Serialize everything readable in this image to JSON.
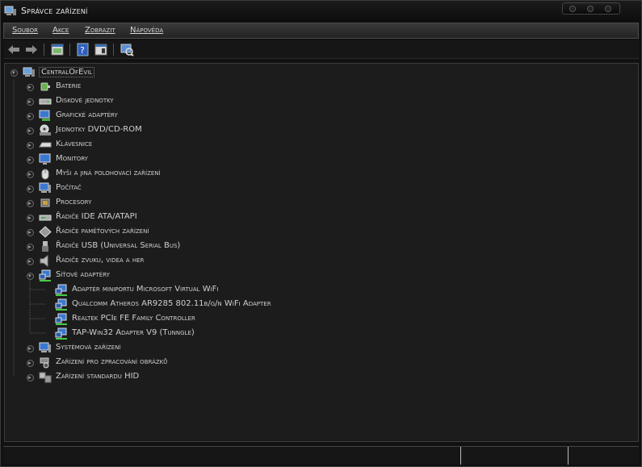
{
  "window": {
    "title": "Správce zařízení"
  },
  "menu": [
    "Soubor",
    "Akce",
    "Zobrazit",
    "Nápověda"
  ],
  "toolbar": {
    "buttons": [
      "back-arrow-icon",
      "forward-arrow-icon",
      "properties-icon",
      "help-icon",
      "view-icon",
      "scan-hardware-icon"
    ]
  },
  "tree": {
    "root": "CentralOfEvil",
    "categories": [
      {
        "label": "Baterie",
        "icon": "battery-icon"
      },
      {
        "label": "Diskové jednotky",
        "icon": "disk-drive-icon"
      },
      {
        "label": "Grafické adaptéry",
        "icon": "display-adapter-icon"
      },
      {
        "label": "Jednotky DVD/CD-ROM",
        "icon": "dvd-drive-icon"
      },
      {
        "label": "Klávesnice",
        "icon": "keyboard-icon"
      },
      {
        "label": "Monitory",
        "icon": "monitor-icon"
      },
      {
        "label": "Myši a jiná polohovací zařízení",
        "icon": "mouse-icon"
      },
      {
        "label": "Počítač",
        "icon": "computer-icon"
      },
      {
        "label": "Procesory",
        "icon": "processor-icon"
      },
      {
        "label": "Řadiče IDE ATA/ATAPI",
        "icon": "ide-controller-icon"
      },
      {
        "label": "Řadiče paměťových zařízení",
        "icon": "storage-controller-icon"
      },
      {
        "label": "Řadiče USB (Universal Serial Bus)",
        "icon": "usb-icon"
      },
      {
        "label": "Řadiče zvuku, videa a her",
        "icon": "sound-icon"
      },
      {
        "label": "Síťové adaptéry",
        "icon": "network-adapter-icon",
        "expanded": true,
        "children": [
          "Adaptér miniportu Microsoft Virtual WiFi",
          "Qualcomm Atheros AR9285 802.11b/g/n WiFi Adapter",
          "Realtek PCIe FE Family Controller",
          "TAP-Win32 Adapter V9 (Tunngle)"
        ]
      },
      {
        "label": "Systémová zařízení",
        "icon": "system-device-icon"
      },
      {
        "label": "Zařízení pro zpracování obrázků",
        "icon": "imaging-device-icon"
      },
      {
        "label": "Zařízení standardu HID",
        "icon": "hid-icon"
      }
    ]
  },
  "colors": {
    "background": "#111111",
    "tree_bg": "#1c1c1c",
    "text": "#cfcfcf",
    "menubar": "#2e2e2e"
  }
}
